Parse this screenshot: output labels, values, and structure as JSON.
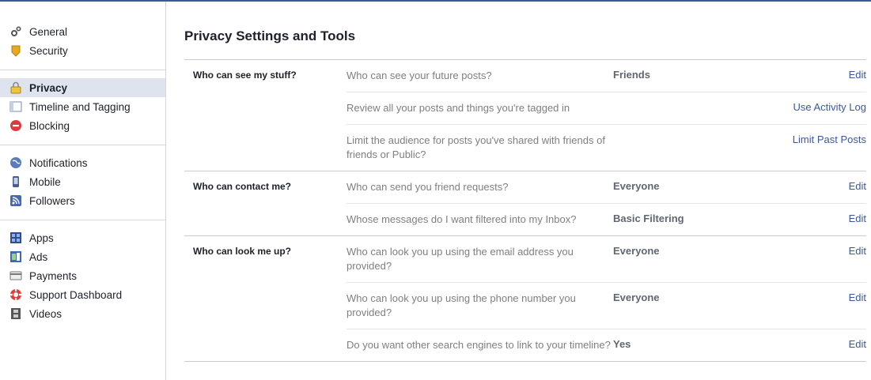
{
  "sidebar": {
    "groups": [
      [
        {
          "label": "General",
          "icon": "gears-icon"
        },
        {
          "label": "Security",
          "icon": "badge-icon"
        }
      ],
      [
        {
          "label": "Privacy",
          "icon": "lock-icon",
          "selected": true
        },
        {
          "label": "Timeline and Tagging",
          "icon": "timeline-icon"
        },
        {
          "label": "Blocking",
          "icon": "block-icon"
        }
      ],
      [
        {
          "label": "Notifications",
          "icon": "globe-icon"
        },
        {
          "label": "Mobile",
          "icon": "phone-icon"
        },
        {
          "label": "Followers",
          "icon": "rss-icon"
        }
      ],
      [
        {
          "label": "Apps",
          "icon": "apps-icon"
        },
        {
          "label": "Ads",
          "icon": "ads-icon"
        },
        {
          "label": "Payments",
          "icon": "card-icon"
        },
        {
          "label": "Support Dashboard",
          "icon": "lifebuoy-icon"
        },
        {
          "label": "Videos",
          "icon": "film-icon"
        }
      ]
    ]
  },
  "main": {
    "title": "Privacy Settings and Tools",
    "sections": [
      {
        "label": "Who can see my stuff?",
        "rows": [
          {
            "question": "Who can see your future posts?",
            "value": "Friends",
            "action": "Edit"
          },
          {
            "question": "Review all your posts and things you're tagged in",
            "value": "",
            "action": "Use Activity Log"
          },
          {
            "question": "Limit the audience for posts you've shared with friends of friends or Public?",
            "value": "",
            "action": "Limit Past Posts"
          }
        ]
      },
      {
        "label": "Who can contact me?",
        "rows": [
          {
            "question": "Who can send you friend requests?",
            "value": "Everyone",
            "action": "Edit"
          },
          {
            "question": "Whose messages do I want filtered into my Inbox?",
            "value": "Basic Filtering",
            "action": "Edit"
          }
        ]
      },
      {
        "label": "Who can look me up?",
        "rows": [
          {
            "question": "Who can look you up using the email address you provided?",
            "value": "Everyone",
            "action": "Edit"
          },
          {
            "question": "Who can look you up using the phone number you provided?",
            "value": "Everyone",
            "action": "Edit"
          },
          {
            "question": "Do you want other search engines to link to your timeline?",
            "value": "Yes",
            "action": "Edit"
          }
        ]
      }
    ]
  },
  "colors": {
    "accent": "#3b5998",
    "selected_bg": "#dfe3ee",
    "question_text": "#7f7f7f"
  }
}
